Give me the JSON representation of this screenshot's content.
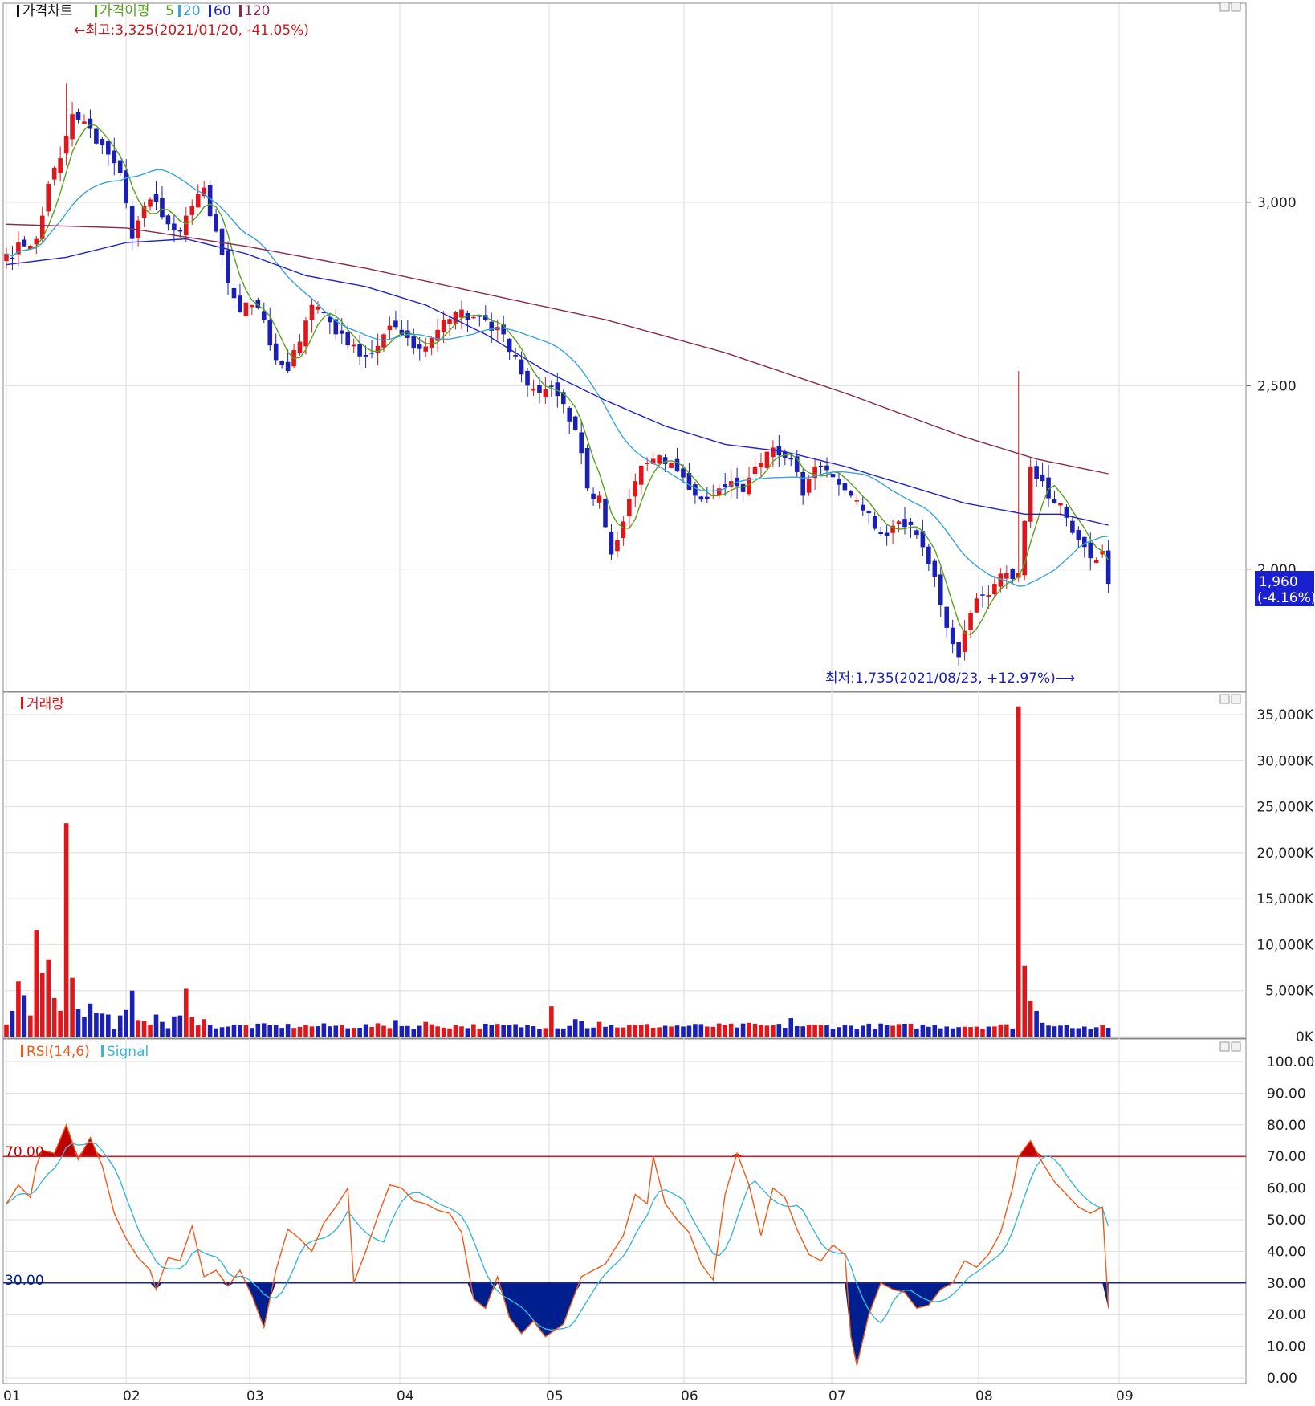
{
  "colors": {
    "up": "#e0161b",
    "down": "#1a1fb5",
    "ma5": "#58a21d",
    "ma20": "#3aa3dd",
    "ma60": "#2222cc",
    "ma120": "#8a2a4a",
    "grid": "#dedede",
    "rsi": "#f05a1a",
    "signal": "#3bb6d9",
    "overbought_fill": "#c00000",
    "oversold_fill": "#001f8f",
    "current_box": "#1a1fd0"
  },
  "panels": {
    "price": {
      "legend": {
        "marker_label": "가격차트",
        "ma_label": "가격이평",
        "p5": "5",
        "p20": "20",
        "p60": "60",
        "p120": "120"
      },
      "high_note": "←최고:3,325(2021/01/20, -41.05%)",
      "low_note": "최저:1,735(2021/08/23, +12.97%)⟶",
      "current_price": "1,960",
      "current_change": "(-4.16%)"
    },
    "volume": {
      "title": "거래량"
    },
    "rsi": {
      "title": "RSI(14,6)",
      "signal_label": "Signal",
      "upper_label": "70.00",
      "lower_label": "30.00"
    }
  },
  "chart_data": [
    {
      "type": "candlestick",
      "title": "가격차트",
      "x_ticks": [
        "01",
        "02",
        "03",
        "04",
        "05",
        "06",
        "07",
        "08",
        "09"
      ],
      "y_ticks": [
        "3,000",
        "2,500",
        "2,000"
      ],
      "ylim": [
        1680,
        3420
      ],
      "anchors": [
        {
          "i": 0,
          "c": 2860
        },
        {
          "i": 3,
          "c": 2880
        },
        {
          "i": 5,
          "c": 2900
        },
        {
          "i": 7,
          "c": 3050
        },
        {
          "i": 9,
          "c": 3120
        },
        {
          "i": 11,
          "c": 3240
        },
        {
          "i": 13,
          "c": 3220
        },
        {
          "i": 15,
          "c": 3160
        },
        {
          "i": 17,
          "c": 3130
        },
        {
          "i": 19,
          "c": 3080
        },
        {
          "i": 21,
          "c": 2900
        },
        {
          "i": 23,
          "c": 2990
        },
        {
          "i": 25,
          "c": 3000
        },
        {
          "i": 27,
          "c": 2940
        },
        {
          "i": 29,
          "c": 2920
        },
        {
          "i": 31,
          "c": 2990
        },
        {
          "i": 33,
          "c": 3040
        },
        {
          "i": 35,
          "c": 2920
        },
        {
          "i": 37,
          "c": 2780
        },
        {
          "i": 39,
          "c": 2700
        },
        {
          "i": 41,
          "c": 2720
        },
        {
          "i": 43,
          "c": 2680
        },
        {
          "i": 45,
          "c": 2570
        },
        {
          "i": 47,
          "c": 2540
        },
        {
          "i": 49,
          "c": 2620
        },
        {
          "i": 51,
          "c": 2720
        },
        {
          "i": 53,
          "c": 2700
        },
        {
          "i": 55,
          "c": 2640
        },
        {
          "i": 57,
          "c": 2610
        },
        {
          "i": 59,
          "c": 2580
        },
        {
          "i": 61,
          "c": 2590
        },
        {
          "i": 63,
          "c": 2640
        },
        {
          "i": 65,
          "c": 2660
        },
        {
          "i": 67,
          "c": 2630
        },
        {
          "i": 69,
          "c": 2600
        },
        {
          "i": 71,
          "c": 2630
        },
        {
          "i": 73,
          "c": 2680
        },
        {
          "i": 75,
          "c": 2700
        },
        {
          "i": 77,
          "c": 2680
        },
        {
          "i": 79,
          "c": 2690
        },
        {
          "i": 81,
          "c": 2650
        },
        {
          "i": 83,
          "c": 2640
        },
        {
          "i": 85,
          "c": 2580
        },
        {
          "i": 87,
          "c": 2500
        },
        {
          "i": 89,
          "c": 2480
        },
        {
          "i": 91,
          "c": 2500
        },
        {
          "i": 93,
          "c": 2450
        },
        {
          "i": 95,
          "c": 2380
        },
        {
          "i": 97,
          "c": 2220
        },
        {
          "i": 99,
          "c": 2200
        },
        {
          "i": 101,
          "c": 2040
        },
        {
          "i": 103,
          "c": 2130
        },
        {
          "i": 105,
          "c": 2240
        },
        {
          "i": 107,
          "c": 2290
        },
        {
          "i": 109,
          "c": 2310
        },
        {
          "i": 111,
          "c": 2290
        },
        {
          "i": 113,
          "c": 2250
        },
        {
          "i": 115,
          "c": 2200
        },
        {
          "i": 117,
          "c": 2190
        },
        {
          "i": 119,
          "c": 2220
        },
        {
          "i": 121,
          "c": 2240
        },
        {
          "i": 123,
          "c": 2210
        },
        {
          "i": 125,
          "c": 2280
        },
        {
          "i": 127,
          "c": 2320
        },
        {
          "i": 129,
          "c": 2310
        },
        {
          "i": 131,
          "c": 2300
        },
        {
          "i": 133,
          "c": 2200
        },
        {
          "i": 135,
          "c": 2280
        },
        {
          "i": 137,
          "c": 2270
        },
        {
          "i": 139,
          "c": 2230
        },
        {
          "i": 141,
          "c": 2200
        },
        {
          "i": 143,
          "c": 2160
        },
        {
          "i": 145,
          "c": 2110
        },
        {
          "i": 147,
          "c": 2090
        },
        {
          "i": 149,
          "c": 2130
        },
        {
          "i": 151,
          "c": 2120
        },
        {
          "i": 153,
          "c": 2060
        },
        {
          "i": 155,
          "c": 1980
        },
        {
          "i": 157,
          "c": 1840
        },
        {
          "i": 159,
          "c": 1760
        },
        {
          "i": 161,
          "c": 1880
        },
        {
          "i": 163,
          "c": 1930
        },
        {
          "i": 165,
          "c": 1960
        },
        {
          "i": 167,
          "c": 1990
        },
        {
          "i": 169,
          "c": 1990
        },
        {
          "i": 171,
          "c": 2280
        },
        {
          "i": 173,
          "c": 2240
        },
        {
          "i": 175,
          "c": 2180
        },
        {
          "i": 177,
          "c": 2140
        },
        {
          "i": 179,
          "c": 2080
        },
        {
          "i": 181,
          "c": 2030
        },
        {
          "i": 183,
          "c": 2050
        },
        {
          "i": 184,
          "c": 1960
        }
      ],
      "ma120_points": [
        [
          0,
          2940
        ],
        [
          20,
          2930
        ],
        [
          40,
          2880
        ],
        [
          60,
          2820
        ],
        [
          80,
          2750
        ],
        [
          100,
          2680
        ],
        [
          120,
          2590
        ],
        [
          140,
          2480
        ],
        [
          160,
          2360
        ],
        [
          172,
          2300
        ],
        [
          184,
          2260
        ]
      ],
      "ma60_points": [
        [
          0,
          2830
        ],
        [
          10,
          2850
        ],
        [
          20,
          2890
        ],
        [
          30,
          2900
        ],
        [
          40,
          2860
        ],
        [
          50,
          2800
        ],
        [
          60,
          2770
        ],
        [
          70,
          2720
        ],
        [
          80,
          2640
        ],
        [
          90,
          2540
        ],
        [
          100,
          2460
        ],
        [
          110,
          2390
        ],
        [
          120,
          2340
        ],
        [
          130,
          2320
        ],
        [
          140,
          2280
        ],
        [
          150,
          2230
        ],
        [
          160,
          2180
        ],
        [
          170,
          2150
        ],
        [
          176,
          2150
        ],
        [
          184,
          2120
        ]
      ]
    },
    {
      "type": "bar",
      "title": "거래량",
      "y_ticks": [
        "35,000K",
        "30,000K",
        "25,000K",
        "20,000K",
        "15,000K",
        "10,000K",
        "5,000K",
        "0K"
      ],
      "ylim": [
        0,
        36000
      ],
      "spikes": [
        {
          "i": 1,
          "v": 2800
        },
        {
          "i": 2,
          "v": 6000
        },
        {
          "i": 3,
          "v": 4500
        },
        {
          "i": 4,
          "v": 2300
        },
        {
          "i": 5,
          "v": 11600
        },
        {
          "i": 6,
          "v": 6900
        },
        {
          "i": 7,
          "v": 8400
        },
        {
          "i": 8,
          "v": 4200
        },
        {
          "i": 9,
          "v": 2800
        },
        {
          "i": 10,
          "v": 23200
        },
        {
          "i": 11,
          "v": 6400
        },
        {
          "i": 12,
          "v": 3000
        },
        {
          "i": 13,
          "v": 2100
        },
        {
          "i": 14,
          "v": 3600
        },
        {
          "i": 15,
          "v": 2600
        },
        {
          "i": 16,
          "v": 2500
        },
        {
          "i": 17,
          "v": 2400
        },
        {
          "i": 19,
          "v": 2300
        },
        {
          "i": 20,
          "v": 2900
        },
        {
          "i": 21,
          "v": 5000
        },
        {
          "i": 22,
          "v": 1800
        },
        {
          "i": 23,
          "v": 1700
        },
        {
          "i": 24,
          "v": 1300
        },
        {
          "i": 25,
          "v": 2400
        },
        {
          "i": 26,
          "v": 1600
        },
        {
          "i": 28,
          "v": 2200
        },
        {
          "i": 29,
          "v": 2300
        },
        {
          "i": 30,
          "v": 5200
        },
        {
          "i": 31,
          "v": 2100
        },
        {
          "i": 33,
          "v": 1900
        },
        {
          "i": 65,
          "v": 1800
        },
        {
          "i": 70,
          "v": 1600
        },
        {
          "i": 91,
          "v": 3300
        },
        {
          "i": 95,
          "v": 1900
        },
        {
          "i": 96,
          "v": 1700
        },
        {
          "i": 99,
          "v": 1600
        },
        {
          "i": 124,
          "v": 1500
        },
        {
          "i": 131,
          "v": 2000
        },
        {
          "i": 169,
          "v": 35900
        },
        {
          "i": 170,
          "v": 7700
        },
        {
          "i": 171,
          "v": 3900
        },
        {
          "i": 172,
          "v": 2800
        },
        {
          "i": 173,
          "v": 1500
        },
        {
          "i": 174,
          "v": 1200
        }
      ],
      "baseline": 850
    },
    {
      "type": "line",
      "title": "RSI(14,6)",
      "series_names": [
        "RSI(14,6)",
        "Signal"
      ],
      "y_ticks": [
        "100.00",
        "90.00",
        "80.00",
        "70.00",
        "60.00",
        "50.00",
        "40.00",
        "30.00",
        "20.00",
        "10.00",
        "0.00"
      ],
      "ylim": [
        0,
        100
      ],
      "upper": 70,
      "lower": 30,
      "rsi_points": [
        [
          0,
          55
        ],
        [
          2,
          61
        ],
        [
          4,
          57
        ],
        [
          5,
          67
        ],
        [
          6,
          72
        ],
        [
          8,
          71
        ],
        [
          10,
          80
        ],
        [
          12,
          69
        ],
        [
          14,
          76
        ],
        [
          16,
          67
        ],
        [
          18,
          52
        ],
        [
          20,
          44
        ],
        [
          22,
          38
        ],
        [
          24,
          34
        ],
        [
          25,
          28
        ],
        [
          27,
          38
        ],
        [
          29,
          37
        ],
        [
          31,
          48
        ],
        [
          33,
          32
        ],
        [
          35,
          34
        ],
        [
          37,
          29
        ],
        [
          39,
          34
        ],
        [
          41,
          26
        ],
        [
          43,
          16
        ],
        [
          45,
          34
        ],
        [
          47,
          47
        ],
        [
          49,
          44
        ],
        [
          51,
          40
        ],
        [
          53,
          49
        ],
        [
          55,
          54
        ],
        [
          57,
          60
        ],
        [
          58,
          30
        ],
        [
          60,
          40
        ],
        [
          62,
          51
        ],
        [
          64,
          61
        ],
        [
          66,
          60
        ],
        [
          68,
          56
        ],
        [
          70,
          55
        ],
        [
          72,
          53
        ],
        [
          74,
          52
        ],
        [
          76,
          46
        ],
        [
          78,
          25
        ],
        [
          80,
          22
        ],
        [
          82,
          32
        ],
        [
          84,
          19
        ],
        [
          86,
          14
        ],
        [
          88,
          18
        ],
        [
          90,
          13
        ],
        [
          93,
          17
        ],
        [
          96,
          32
        ],
        [
          98,
          34
        ],
        [
          100,
          36
        ],
        [
          103,
          45
        ],
        [
          105,
          58
        ],
        [
          107,
          55
        ],
        [
          108,
          70
        ],
        [
          110,
          55
        ],
        [
          112,
          50
        ],
        [
          114,
          46
        ],
        [
          116,
          36
        ],
        [
          118,
          31
        ],
        [
          120,
          58
        ],
        [
          122,
          71
        ],
        [
          124,
          61
        ],
        [
          126,
          45
        ],
        [
          128,
          60
        ],
        [
          130,
          57
        ],
        [
          132,
          47
        ],
        [
          134,
          39
        ],
        [
          136,
          37
        ],
        [
          138,
          42
        ],
        [
          140,
          39
        ],
        [
          141,
          13
        ],
        [
          142,
          4
        ],
        [
          144,
          20
        ],
        [
          146,
          30
        ],
        [
          148,
          28
        ],
        [
          150,
          27
        ],
        [
          152,
          22
        ],
        [
          154,
          23
        ],
        [
          156,
          28
        ],
        [
          158,
          30
        ],
        [
          160,
          37
        ],
        [
          162,
          35
        ],
        [
          164,
          39
        ],
        [
          166,
          46
        ],
        [
          168,
          60
        ],
        [
          169,
          70
        ],
        [
          171,
          75
        ],
        [
          173,
          68
        ],
        [
          175,
          62
        ],
        [
          177,
          58
        ],
        [
          179,
          54
        ],
        [
          181,
          52
        ],
        [
          183,
          54
        ],
        [
          184,
          22
        ]
      ]
    }
  ]
}
